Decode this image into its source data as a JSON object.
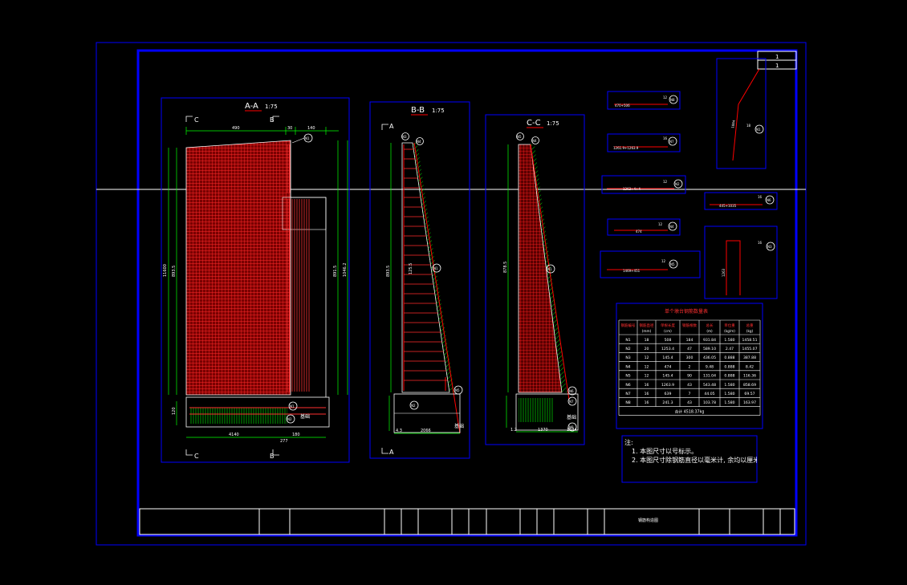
{
  "sections": {
    "aa": {
      "title": "A-A",
      "scale": "1:75"
    },
    "bb": {
      "title": "B-B",
      "scale": "1:75"
    },
    "cc": {
      "title": "C-C",
      "scale": "1:75"
    }
  },
  "cut_marks": {
    "c": "C",
    "b": "B",
    "a": "A"
  },
  "dims": {
    "aa_top_1": "490",
    "aa_top_2": "30",
    "aa_top_3": "140",
    "aa_left_total": "11600",
    "aa_left_inner": "893.5",
    "aa_right_total": "1046.2",
    "aa_right_inner": "891.5",
    "aa_base_h": "120",
    "aa_base_w": "4140",
    "aa_base_r1": "180",
    "aa_base_r2": "277",
    "bb_height": "893.5",
    "bb_mid": "125.5",
    "bb_base": "2066",
    "bb_left": "4.3",
    "cc_height": "878.5",
    "cc_base": "1370",
    "cc_left": "1.2",
    "cc_right": "1544"
  },
  "labels": {
    "foundation": "基础"
  },
  "markers": [
    "N1",
    "N2",
    "N3",
    "N4",
    "N5",
    "N6",
    "N7",
    "N8"
  ],
  "rebar_details": [
    {
      "id": "N8",
      "spec": "12",
      "text": "470+506"
    },
    {
      "id": "N7",
      "spec": "16",
      "text": "1261.9+1263.9"
    },
    {
      "id": "N2",
      "spec": "12",
      "text": "1263+4+4"
    },
    {
      "id": "N4",
      "spec": "12",
      "text": "474"
    },
    {
      "id": "N5",
      "spec": "12",
      "text": "1469+451"
    },
    {
      "id": "N6",
      "spec": "16",
      "text": "445+1035"
    },
    {
      "id": "N3",
      "spec": "16",
      "text": "1263"
    },
    {
      "id": "N1",
      "spec": "18",
      "text": "1884"
    }
  ],
  "table": {
    "title": "单个墩台钢筋数量表",
    "headers": [
      "钢筋编号",
      "钢筋直径(mm)",
      "单根长度(cm)",
      "钢筋根数",
      "总长(m)",
      "单位重(kg/m)",
      "总重(kg)"
    ],
    "rows": [
      [
        "N1",
        "18",
        "508",
        "184",
        "931.84",
        "1.580",
        "1458.51"
      ],
      [
        "N2",
        "20",
        "1253.4",
        "47",
        "589.10",
        "2.47",
        "1455.07"
      ],
      [
        "N3",
        "12",
        "145.4",
        "300",
        "436.05",
        "0.888",
        "387.88"
      ],
      [
        "N4",
        "12",
        "474",
        "2",
        "9.48",
        "0.888",
        "8.42"
      ],
      [
        "N5",
        "12",
        "145.4",
        "90",
        "131.04",
        "0.888",
        "116.36"
      ],
      [
        "N6",
        "16",
        "1263.9",
        "43",
        "543.48",
        "1.580",
        "858.69"
      ],
      [
        "N7",
        "16",
        "639",
        "7",
        "44.05",
        "1.580",
        "69.57"
      ],
      [
        "N8",
        "16",
        "241.3",
        "43",
        "103.78",
        "1.580",
        "163.97"
      ]
    ],
    "total": "合计 4518.37kg"
  },
  "notes": {
    "title": "注:",
    "line1": "1. 本图尺寸以号标示。",
    "line2": "2. 本图尺寸除钢筋直径以毫米计, 余均以厘米为单位。"
  },
  "title_block": {
    "caption": "钢筋构造图",
    "sheet_a": "1",
    "sheet_b": "1"
  },
  "colors": {
    "frame": "#0000ff",
    "outline": "#ffffff",
    "rebar": "#ff0000",
    "hatch": "#00ff00",
    "section_title": "#ffffff",
    "marker": "#ffffff"
  }
}
